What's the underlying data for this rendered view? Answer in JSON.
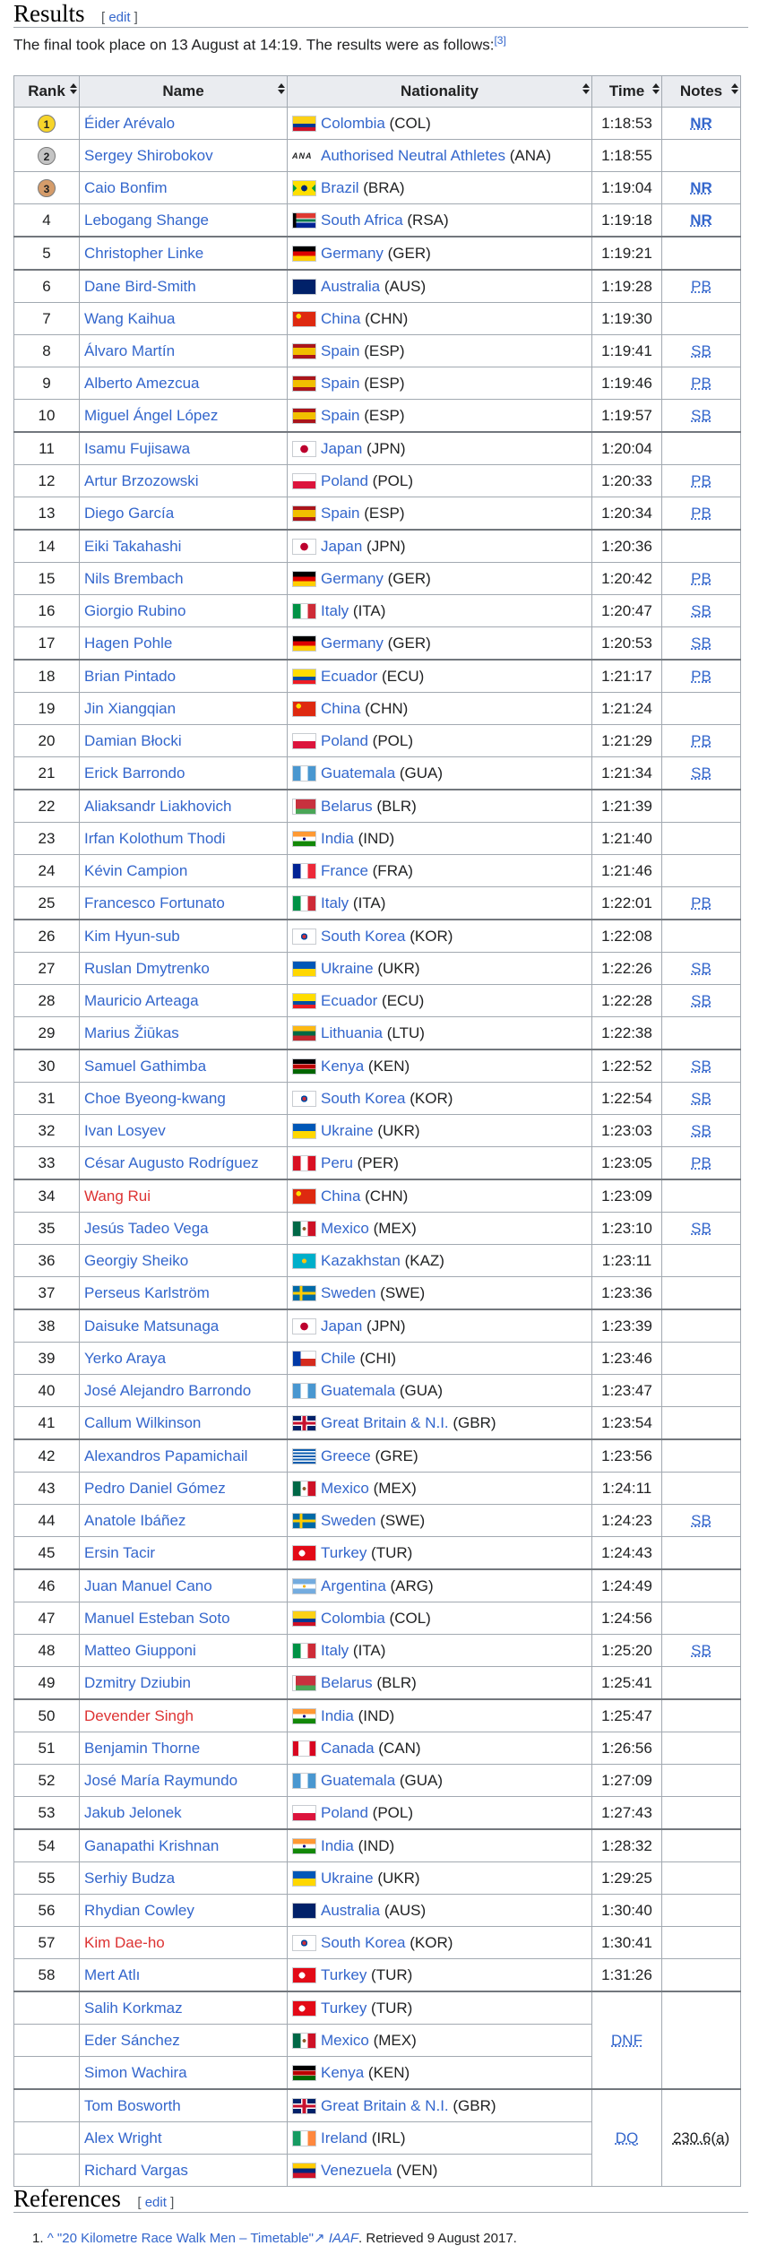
{
  "results": {
    "title": "Results",
    "edit": "edit"
  },
  "intro": {
    "text": "The final took place on 13 August at 14:19. The results were as follows:",
    "ref": "[3]"
  },
  "table": {
    "headers": {
      "rank": "Rank",
      "name": "Name",
      "nationality": "Nationality",
      "time": "Time",
      "notes": "Notes"
    },
    "rows": [
      {
        "rank": "1",
        "medal": "gold",
        "name": "Éider Arévalo",
        "flag": "col",
        "country": "Colombia",
        "code": "(COL)",
        "time": "1:18:53",
        "note": "NR"
      },
      {
        "rank": "2",
        "medal": "silver",
        "name": "Sergey Shirobokov",
        "flag": "ana",
        "country": "Authorised Neutral Athletes",
        "code": "(ANA)",
        "time": "1:18:55",
        "note": ""
      },
      {
        "rank": "3",
        "medal": "bronze",
        "name": "Caio Bonfim",
        "flag": "bra",
        "country": "Brazil",
        "code": "(BRA)",
        "time": "1:19:04",
        "note": "NR"
      },
      {
        "rank": "4",
        "name": "Lebogang Shange",
        "flag": "rsa",
        "country": "South Africa",
        "code": "(RSA)",
        "time": "1:19:18",
        "note": "NR"
      },
      {
        "rank": "5",
        "name": "Christopher Linke",
        "flag": "ger",
        "country": "Germany",
        "code": "(GER)",
        "time": "1:19:21",
        "note": ""
      },
      {
        "rank": "6",
        "name": "Dane Bird-Smith",
        "flag": "aus",
        "country": "Australia",
        "code": "(AUS)",
        "time": "1:19:28",
        "note": "PB"
      },
      {
        "rank": "7",
        "name": "Wang Kaihua",
        "flag": "chn",
        "country": "China",
        "code": "(CHN)",
        "time": "1:19:30",
        "note": ""
      },
      {
        "rank": "8",
        "name": "Álvaro Martín",
        "flag": "esp",
        "country": "Spain",
        "code": "(ESP)",
        "time": "1:19:41",
        "note": "SB"
      },
      {
        "rank": "9",
        "name": "Alberto Amezcua",
        "flag": "esp",
        "country": "Spain",
        "code": "(ESP)",
        "time": "1:19:46",
        "note": "PB"
      },
      {
        "rank": "10",
        "name": "Miguel Ángel López",
        "flag": "esp",
        "country": "Spain",
        "code": "(ESP)",
        "time": "1:19:57",
        "note": "SB"
      },
      {
        "rank": "11",
        "name": "Isamu Fujisawa",
        "flag": "jpn",
        "country": "Japan",
        "code": "(JPN)",
        "time": "1:20:04",
        "note": ""
      },
      {
        "rank": "12",
        "name": "Artur Brzozowski",
        "flag": "pol",
        "country": "Poland",
        "code": "(POL)",
        "time": "1:20:33",
        "note": "PB"
      },
      {
        "rank": "13",
        "name": "Diego García",
        "flag": "esp",
        "country": "Spain",
        "code": "(ESP)",
        "time": "1:20:34",
        "note": "PB"
      },
      {
        "rank": "14",
        "name": "Eiki Takahashi",
        "flag": "jpn",
        "country": "Japan",
        "code": "(JPN)",
        "time": "1:20:36",
        "note": ""
      },
      {
        "rank": "15",
        "name": "Nils Brembach",
        "flag": "ger",
        "country": "Germany",
        "code": "(GER)",
        "time": "1:20:42",
        "note": "PB"
      },
      {
        "rank": "16",
        "name": "Giorgio Rubino",
        "flag": "ita",
        "country": "Italy",
        "code": "(ITA)",
        "time": "1:20:47",
        "note": "SB"
      },
      {
        "rank": "17",
        "name": "Hagen Pohle",
        "flag": "ger",
        "country": "Germany",
        "code": "(GER)",
        "time": "1:20:53",
        "note": "SB"
      },
      {
        "rank": "18",
        "name": "Brian Pintado",
        "flag": "ecu",
        "country": "Ecuador",
        "code": "(ECU)",
        "time": "1:21:17",
        "note": "PB"
      },
      {
        "rank": "19",
        "name": "Jin Xiangqian",
        "flag": "chn",
        "country": "China",
        "code": "(CHN)",
        "time": "1:21:24",
        "note": ""
      },
      {
        "rank": "20",
        "name": "Damian Błocki",
        "flag": "pol",
        "country": "Poland",
        "code": "(POL)",
        "time": "1:21:29",
        "note": "PB"
      },
      {
        "rank": "21",
        "name": "Erick Barrondo",
        "flag": "gua",
        "country": "Guatemala",
        "code": "(GUA)",
        "time": "1:21:34",
        "note": "SB"
      },
      {
        "rank": "22",
        "name": "Aliaksandr Liakhovich",
        "flag": "blr",
        "country": "Belarus",
        "code": "(BLR)",
        "time": "1:21:39",
        "note": ""
      },
      {
        "rank": "23",
        "name": "Irfan Kolothum Thodi",
        "flag": "ind",
        "country": "India",
        "code": "(IND)",
        "time": "1:21:40",
        "note": ""
      },
      {
        "rank": "24",
        "name": "Kévin Campion",
        "flag": "fra",
        "country": "France",
        "code": "(FRA)",
        "time": "1:21:46",
        "note": ""
      },
      {
        "rank": "25",
        "name": "Francesco Fortunato",
        "flag": "ita",
        "country": "Italy",
        "code": "(ITA)",
        "time": "1:22:01",
        "note": "PB"
      },
      {
        "rank": "26",
        "name": "Kim Hyun-sub",
        "flag": "kor",
        "country": "South Korea",
        "code": "(KOR)",
        "time": "1:22:08",
        "note": ""
      },
      {
        "rank": "27",
        "name": "Ruslan Dmytrenko",
        "flag": "ukr",
        "country": "Ukraine",
        "code": "(UKR)",
        "time": "1:22:26",
        "note": "SB"
      },
      {
        "rank": "28",
        "name": "Mauricio Arteaga",
        "flag": "ecu",
        "country": "Ecuador",
        "code": "(ECU)",
        "time": "1:22:28",
        "note": "SB"
      },
      {
        "rank": "29",
        "name": "Marius Žiūkas",
        "flag": "ltu",
        "country": "Lithuania",
        "code": "(LTU)",
        "time": "1:22:38",
        "note": ""
      },
      {
        "rank": "30",
        "name": "Samuel Gathimba",
        "flag": "ken",
        "country": "Kenya",
        "code": "(KEN)",
        "time": "1:22:52",
        "note": "SB"
      },
      {
        "rank": "31",
        "name": "Choe Byeong-kwang",
        "flag": "kor",
        "country": "South Korea",
        "code": "(KOR)",
        "time": "1:22:54",
        "note": "SB"
      },
      {
        "rank": "32",
        "name": "Ivan Losyev",
        "flag": "ukr",
        "country": "Ukraine",
        "code": "(UKR)",
        "time": "1:23:03",
        "note": "SB"
      },
      {
        "rank": "33",
        "name": "César Augusto Rodríguez",
        "flag": "per",
        "country": "Peru",
        "code": "(PER)",
        "time": "1:23:05",
        "note": "PB"
      },
      {
        "rank": "34",
        "name": "Wang Rui",
        "red": true,
        "flag": "chn",
        "country": "China",
        "code": "(CHN)",
        "time": "1:23:09",
        "note": ""
      },
      {
        "rank": "35",
        "name": "Jesús Tadeo Vega",
        "flag": "mex",
        "country": "Mexico",
        "code": "(MEX)",
        "time": "1:23:10",
        "note": "SB"
      },
      {
        "rank": "36",
        "name": "Georgiy Sheiko",
        "flag": "kaz",
        "country": "Kazakhstan",
        "code": "(KAZ)",
        "time": "1:23:11",
        "note": ""
      },
      {
        "rank": "37",
        "name": "Perseus Karlström",
        "flag": "swe",
        "country": "Sweden",
        "code": "(SWE)",
        "time": "1:23:36",
        "note": ""
      },
      {
        "rank": "38",
        "name": "Daisuke Matsunaga",
        "flag": "jpn",
        "country": "Japan",
        "code": "(JPN)",
        "time": "1:23:39",
        "note": ""
      },
      {
        "rank": "39",
        "name": "Yerko Araya",
        "flag": "chi",
        "country": "Chile",
        "code": "(CHI)",
        "time": "1:23:46",
        "note": ""
      },
      {
        "rank": "40",
        "name": "José Alejandro Barrondo",
        "flag": "gua",
        "country": "Guatemala",
        "code": "(GUA)",
        "time": "1:23:47",
        "note": ""
      },
      {
        "rank": "41",
        "name": "Callum Wilkinson",
        "flag": "gbr",
        "country": "Great Britain & N.I.",
        "code": "(GBR)",
        "time": "1:23:54",
        "note": ""
      },
      {
        "rank": "42",
        "name": "Alexandros Papamichail",
        "flag": "gre",
        "country": "Greece",
        "code": "(GRE)",
        "time": "1:23:56",
        "note": ""
      },
      {
        "rank": "43",
        "name": "Pedro Daniel Gómez",
        "flag": "mex",
        "country": "Mexico",
        "code": "(MEX)",
        "time": "1:24:11",
        "note": ""
      },
      {
        "rank": "44",
        "name": "Anatole Ibáñez",
        "flag": "swe",
        "country": "Sweden",
        "code": "(SWE)",
        "time": "1:24:23",
        "note": "SB"
      },
      {
        "rank": "45",
        "name": "Ersin Tacir",
        "flag": "tur",
        "country": "Turkey",
        "code": "(TUR)",
        "time": "1:24:43",
        "note": ""
      },
      {
        "rank": "46",
        "name": "Juan Manuel Cano",
        "flag": "arg",
        "country": "Argentina",
        "code": "(ARG)",
        "time": "1:24:49",
        "note": ""
      },
      {
        "rank": "47",
        "name": "Manuel Esteban Soto",
        "flag": "col",
        "country": "Colombia",
        "code": "(COL)",
        "time": "1:24:56",
        "note": ""
      },
      {
        "rank": "48",
        "name": "Matteo Giupponi",
        "flag": "ita",
        "country": "Italy",
        "code": "(ITA)",
        "time": "1:25:20",
        "note": "SB"
      },
      {
        "rank": "49",
        "name": "Dzmitry Dziubin",
        "flag": "blr",
        "country": "Belarus",
        "code": "(BLR)",
        "time": "1:25:41",
        "note": ""
      },
      {
        "rank": "50",
        "name": "Devender Singh",
        "red": true,
        "flag": "ind",
        "country": "India",
        "code": "(IND)",
        "time": "1:25:47",
        "note": ""
      },
      {
        "rank": "51",
        "name": "Benjamin Thorne",
        "flag": "can",
        "country": "Canada",
        "code": "(CAN)",
        "time": "1:26:56",
        "note": ""
      },
      {
        "rank": "52",
        "name": "José María Raymundo",
        "flag": "gua",
        "country": "Guatemala",
        "code": "(GUA)",
        "time": "1:27:09",
        "note": ""
      },
      {
        "rank": "53",
        "name": "Jakub Jelonek",
        "flag": "pol",
        "country": "Poland",
        "code": "(POL)",
        "time": "1:27:43",
        "note": ""
      },
      {
        "rank": "54",
        "name": "Ganapathi Krishnan",
        "flag": "ind",
        "country": "India",
        "code": "(IND)",
        "time": "1:28:32",
        "note": ""
      },
      {
        "rank": "55",
        "name": "Serhiy Budza",
        "flag": "ukr",
        "country": "Ukraine",
        "code": "(UKR)",
        "time": "1:29:25",
        "note": ""
      },
      {
        "rank": "56",
        "name": "Rhydian Cowley",
        "flag": "aus",
        "country": "Australia",
        "code": "(AUS)",
        "time": "1:30:40",
        "note": ""
      },
      {
        "rank": "57",
        "name": "Kim Dae-ho",
        "red": true,
        "flag": "kor",
        "country": "South Korea",
        "code": "(KOR)",
        "time": "1:30:41",
        "note": ""
      },
      {
        "rank": "58",
        "name": "Mert Atlı",
        "flag": "tur",
        "country": "Turkey",
        "code": "(TUR)",
        "time": "1:31:26",
        "note": ""
      },
      {
        "rank": "",
        "name": "Salih Korkmaz",
        "flag": "tur",
        "country": "Turkey",
        "code": "(TUR)",
        "time": "",
        "note": ""
      },
      {
        "rank": "",
        "name": "Eder Sánchez",
        "flag": "mex",
        "country": "Mexico",
        "code": "(MEX)",
        "time": "",
        "note": ""
      },
      {
        "rank": "",
        "name": "Simon Wachira",
        "flag": "ken",
        "country": "Kenya",
        "code": "(KEN)",
        "time": "",
        "note": ""
      },
      {
        "rank": "",
        "name": "Tom Bosworth",
        "flag": "gbr",
        "country": "Great Britain & N.I.",
        "code": "(GBR)",
        "time": "",
        "note": ""
      },
      {
        "rank": "",
        "name": "Alex Wright",
        "flag": "irl",
        "country": "Ireland",
        "code": "(IRL)",
        "time": "",
        "note": ""
      },
      {
        "rank": "",
        "name": "Richard Vargas",
        "flag": "ven",
        "country": "Venezuela",
        "code": "(VEN)",
        "time": "",
        "note": ""
      }
    ],
    "dnf": {
      "label": "DNF"
    },
    "dq": {
      "label": "DQ",
      "note": "230.6(a)"
    }
  },
  "references": {
    "title": "References",
    "edit": "edit"
  },
  "ref1": {
    "num": "1.",
    "caret": "^",
    "link": "\"20 Kilometre Race Walk Men – Timetable\"",
    "ext_icon": "external-link-icon",
    "pub": "IAAF",
    "retrieved": "Retrieved 9 August 2017."
  }
}
